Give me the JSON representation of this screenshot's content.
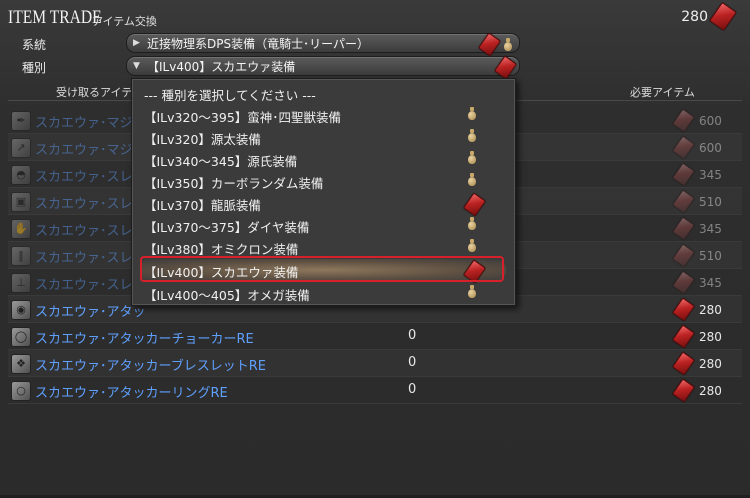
{
  "window": {
    "title": "ITEM TRADE",
    "subtitle": "アイテム交換",
    "currency_amount": "280",
    "currency_icon": "red-token-icon"
  },
  "filters": {
    "category_label": "系統",
    "category_value": "近接物理系DPS装備（竜騎士･リーパー）",
    "type_label": "種別",
    "type_value": "【ILv400】スカエウァ装備"
  },
  "list": {
    "col_receive": "受け取るアイテム",
    "col_required": "必要アイテム",
    "rows": [
      {
        "name": "スカエウァ･マジテ",
        "qty": "",
        "cost": "600",
        "icon": "feather-icon",
        "faded": true
      },
      {
        "name": "スカエウァ･マジテ",
        "qty": "",
        "cost": "600",
        "icon": "spear-icon",
        "faded": true
      },
      {
        "name": "スカエウァ･スレイ",
        "qty": "",
        "cost": "345",
        "icon": "helmet-icon",
        "faded": true
      },
      {
        "name": "スカエウァ･スレイ",
        "qty": "",
        "cost": "510",
        "icon": "armor-icon",
        "faded": true
      },
      {
        "name": "スカエウァ･スレイ",
        "qty": "",
        "cost": "345",
        "icon": "gauntlet-icon",
        "faded": true
      },
      {
        "name": "スカエウァ･スレイ",
        "qty": "",
        "cost": "510",
        "icon": "legs-icon",
        "faded": true
      },
      {
        "name": "スカエウァ･スレイ",
        "qty": "",
        "cost": "345",
        "icon": "boots-icon",
        "faded": true
      },
      {
        "name": "スカエウァ･アタッ",
        "qty": "",
        "cost": "280",
        "icon": "earring-icon",
        "faded": false
      },
      {
        "name": "スカエウァ･アタッカーチョーカーRE",
        "qty": "0",
        "cost": "280",
        "icon": "choker-icon",
        "faded": false
      },
      {
        "name": "スカエウァ･アタッカーブレスレットRE",
        "qty": "0",
        "cost": "280",
        "icon": "bracelet-icon",
        "faded": false
      },
      {
        "name": "スカエウァ･アタッカーリングRE",
        "qty": "0",
        "cost": "280",
        "icon": "ring-icon",
        "faded": false
      }
    ]
  },
  "dropdown": {
    "items": [
      {
        "label": "--- 種別を選択してください ---",
        "icon": ""
      },
      {
        "label": "【ILv320～395】蛮神･四聖獣装備",
        "icon": "bag"
      },
      {
        "label": "【ILv320】源太装備",
        "icon": "bag"
      },
      {
        "label": "【ILv340～345】源氏装備",
        "icon": "bag"
      },
      {
        "label": "【ILv350】カーボランダム装備",
        "icon": "bag"
      },
      {
        "label": "【ILv370】龍脈装備",
        "icon": "token"
      },
      {
        "label": "【ILv370～375】ダイヤ装備",
        "icon": "bag"
      },
      {
        "label": "【ILv380】オミクロン装備",
        "icon": "bag"
      },
      {
        "label": "【ILv400】スカエウァ装備",
        "icon": "token",
        "selected": true
      },
      {
        "label": "【ILv400～405】オメガ装備",
        "icon": "bag"
      }
    ]
  }
}
